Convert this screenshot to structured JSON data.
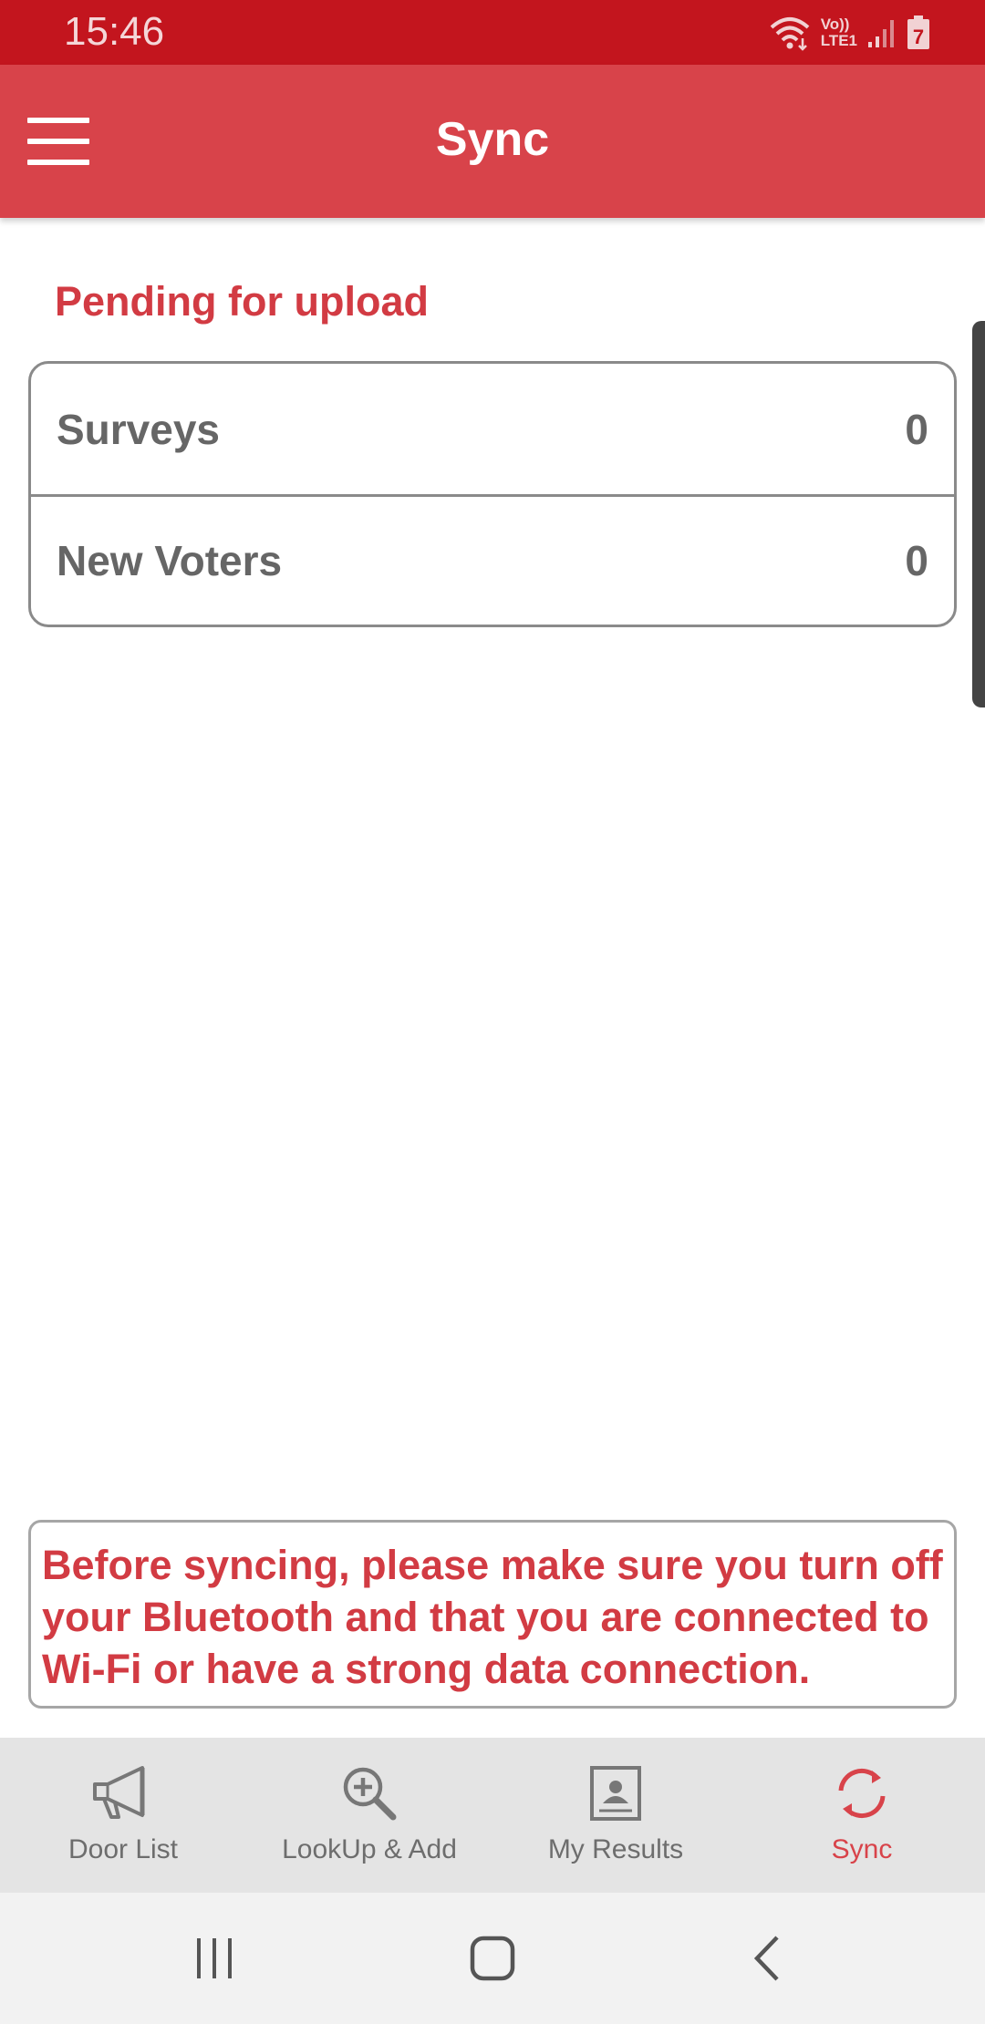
{
  "status_bar": {
    "time": "15:46",
    "network_label_top": "Vo))",
    "network_label_bottom": "LTE1",
    "battery_level": "7"
  },
  "app_bar": {
    "title": "Sync",
    "menu_icon": "hamburger-menu-icon"
  },
  "pending": {
    "heading": "Pending for upload",
    "rows": [
      {
        "label": "Surveys",
        "count": "0"
      },
      {
        "label": "New Voters",
        "count": "0"
      }
    ]
  },
  "notice": {
    "text": "Before syncing, please make sure you turn off your Bluetooth and that you are connected to Wi-Fi or have a strong data connection."
  },
  "bottom_nav": {
    "items": [
      {
        "label": "Door List",
        "icon": "megaphone-icon",
        "active": false
      },
      {
        "label": "LookUp & Add",
        "icon": "zoom-in-icon",
        "active": false
      },
      {
        "label": "My Results",
        "icon": "contact-card-icon",
        "active": false
      },
      {
        "label": "Sync",
        "icon": "sync-icon",
        "active": true
      }
    ]
  },
  "colors": {
    "status_bar": "#c3151e",
    "app_bar": "#d8434a",
    "accent_text": "#d23b43",
    "row_text": "#666666",
    "nav_bg": "#e4e4e4",
    "nav_inactive": "#6d6d6d"
  }
}
